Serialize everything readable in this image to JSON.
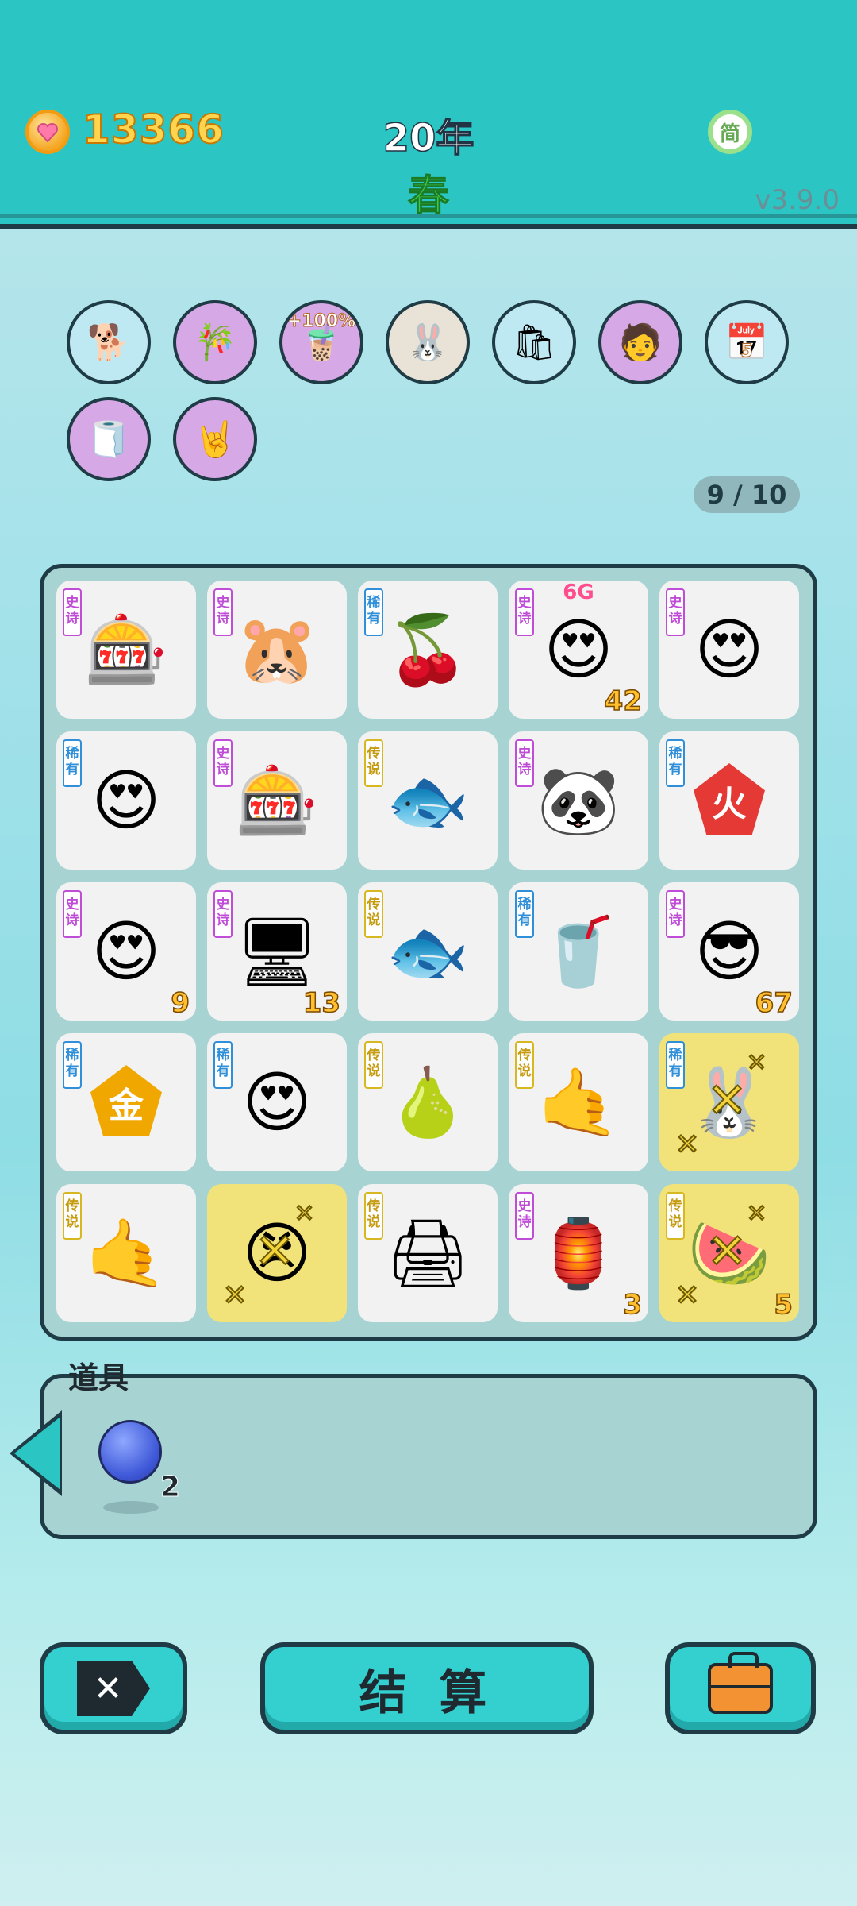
{
  "header": {
    "coins": "13366",
    "year": "20年",
    "season": "春",
    "lang_button": "简",
    "version": "v3.9.0"
  },
  "buffs": [
    {
      "name": "husky-dog-buff",
      "icon": "🐕"
    },
    {
      "name": "bamboo-buff",
      "icon": "🎋"
    },
    {
      "name": "milk-tea-plus100-buff",
      "icon": "🧋",
      "label": "+100%"
    },
    {
      "name": "bunny-buff",
      "icon": "🐰"
    },
    {
      "name": "rice-bag-buff",
      "icon": "🛍"
    },
    {
      "name": "multiplier-head-buff",
      "icon": "🧑"
    },
    {
      "name": "calendar-buff",
      "icon": "📅",
      "label": "5"
    },
    {
      "name": "tissue-box-buff",
      "icon": "🧻"
    },
    {
      "name": "rock-hand-buff",
      "icon": "🤘"
    }
  ],
  "board_counter": "9 / 10",
  "rarity_labels": {
    "epic": "史诗",
    "rare": "稀有",
    "legend": "传说"
  },
  "board": [
    {
      "rarity": "epic",
      "icon": "🎰",
      "name": "capsule-machine"
    },
    {
      "rarity": "epic",
      "icon": "🐹",
      "name": "groundhog"
    },
    {
      "rarity": "rare",
      "icon": "🍒",
      "name": "lychee"
    },
    {
      "rarity": "epic",
      "icon": "😍",
      "name": "heart-eyes-girl",
      "top": "6G",
      "count": "42"
    },
    {
      "rarity": "epic",
      "icon": "😍",
      "name": "heart-eyes-girl"
    },
    {
      "rarity": "rare",
      "icon": "😍",
      "name": "bald-heart-eyes"
    },
    {
      "rarity": "epic",
      "icon": "🎰",
      "name": "capsule-machine"
    },
    {
      "rarity": "legend",
      "icon": "🐟",
      "name": "koi-fish"
    },
    {
      "rarity": "epic",
      "icon": "🐼",
      "name": "panda"
    },
    {
      "rarity": "rare",
      "icon": "火",
      "name": "fire-element"
    },
    {
      "rarity": "epic",
      "icon": "😍",
      "name": "heart-eyes-girl",
      "count": "9"
    },
    {
      "rarity": "epic",
      "icon": "🖥",
      "name": "graphics-card",
      "count": "13"
    },
    {
      "rarity": "legend",
      "icon": "🐟",
      "name": "koi-fish"
    },
    {
      "rarity": "rare",
      "icon": "🥤",
      "name": "milk-tea"
    },
    {
      "rarity": "epic",
      "icon": "😎",
      "name": "green-hat-man",
      "count": "67"
    },
    {
      "rarity": "rare",
      "icon": "金",
      "name": "gold-element"
    },
    {
      "rarity": "rare",
      "icon": "😍",
      "name": "heart-eyes-boy"
    },
    {
      "rarity": "legend",
      "icon": "🍐",
      "name": "longan-fruit"
    },
    {
      "rarity": "legend",
      "icon": "🤙",
      "name": "pointing-hand"
    },
    {
      "rarity": "rare",
      "icon": "🐰",
      "name": "bunny-gift",
      "highlight": true
    },
    {
      "rarity": "legend",
      "icon": "🤙",
      "name": "pointing-hand"
    },
    {
      "rarity": "",
      "icon": "😠",
      "name": "rapper-man",
      "highlight": true
    },
    {
      "rarity": "legend",
      "icon": "🖨",
      "name": "printer"
    },
    {
      "rarity": "epic",
      "icon": "🏮",
      "name": "bunny-house",
      "count": "3"
    },
    {
      "rarity": "legend",
      "icon": "🍉",
      "name": "watermelon",
      "count": "5",
      "highlight": true
    }
  ],
  "items": {
    "title": "道具",
    "berry_count": "2"
  },
  "buttons": {
    "settle": "结 算"
  }
}
